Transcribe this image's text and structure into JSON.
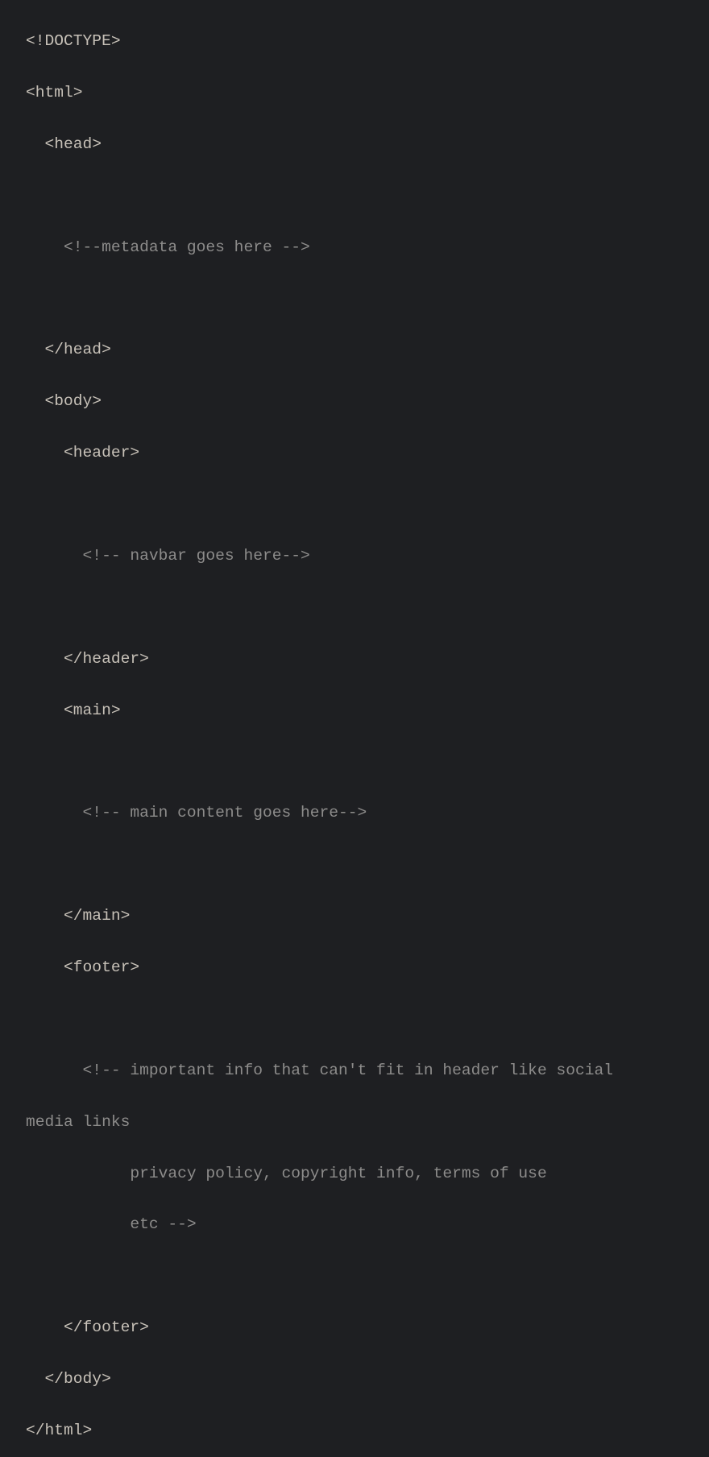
{
  "code": {
    "lines": [
      {
        "text": "<!DOCTYPE>",
        "kind": "tag"
      },
      {
        "text": "<html>",
        "kind": "tag"
      },
      {
        "text": "  <head>",
        "kind": "tag"
      },
      {
        "text": "",
        "kind": "blank"
      },
      {
        "text": "    <!--metadata goes here -->",
        "kind": "comment"
      },
      {
        "text": "",
        "kind": "blank"
      },
      {
        "text": "  </head>",
        "kind": "tag"
      },
      {
        "text": "  <body>",
        "kind": "tag"
      },
      {
        "text": "    <header>",
        "kind": "tag"
      },
      {
        "text": "",
        "kind": "blank"
      },
      {
        "text": "      <!-- navbar goes here-->",
        "kind": "comment"
      },
      {
        "text": "",
        "kind": "blank"
      },
      {
        "text": "    </header>",
        "kind": "tag"
      },
      {
        "text": "    <main>",
        "kind": "tag"
      },
      {
        "text": "",
        "kind": "blank"
      },
      {
        "text": "      <!-- main content goes here-->",
        "kind": "comment"
      },
      {
        "text": "",
        "kind": "blank"
      },
      {
        "text": "    </main>",
        "kind": "tag"
      },
      {
        "text": "    <footer>",
        "kind": "tag"
      },
      {
        "text": "",
        "kind": "blank"
      },
      {
        "text": "      <!-- important info that can't fit in header like social",
        "kind": "comment"
      },
      {
        "text": "media links",
        "kind": "comment"
      },
      {
        "text": "           privacy policy, copyright info, terms of use",
        "kind": "comment"
      },
      {
        "text": "           etc -->",
        "kind": "comment"
      },
      {
        "text": "",
        "kind": "blank"
      },
      {
        "text": "    </footer>",
        "kind": "tag"
      },
      {
        "text": "  </body>",
        "kind": "tag"
      },
      {
        "text": "</html>",
        "kind": "tag"
      }
    ]
  }
}
